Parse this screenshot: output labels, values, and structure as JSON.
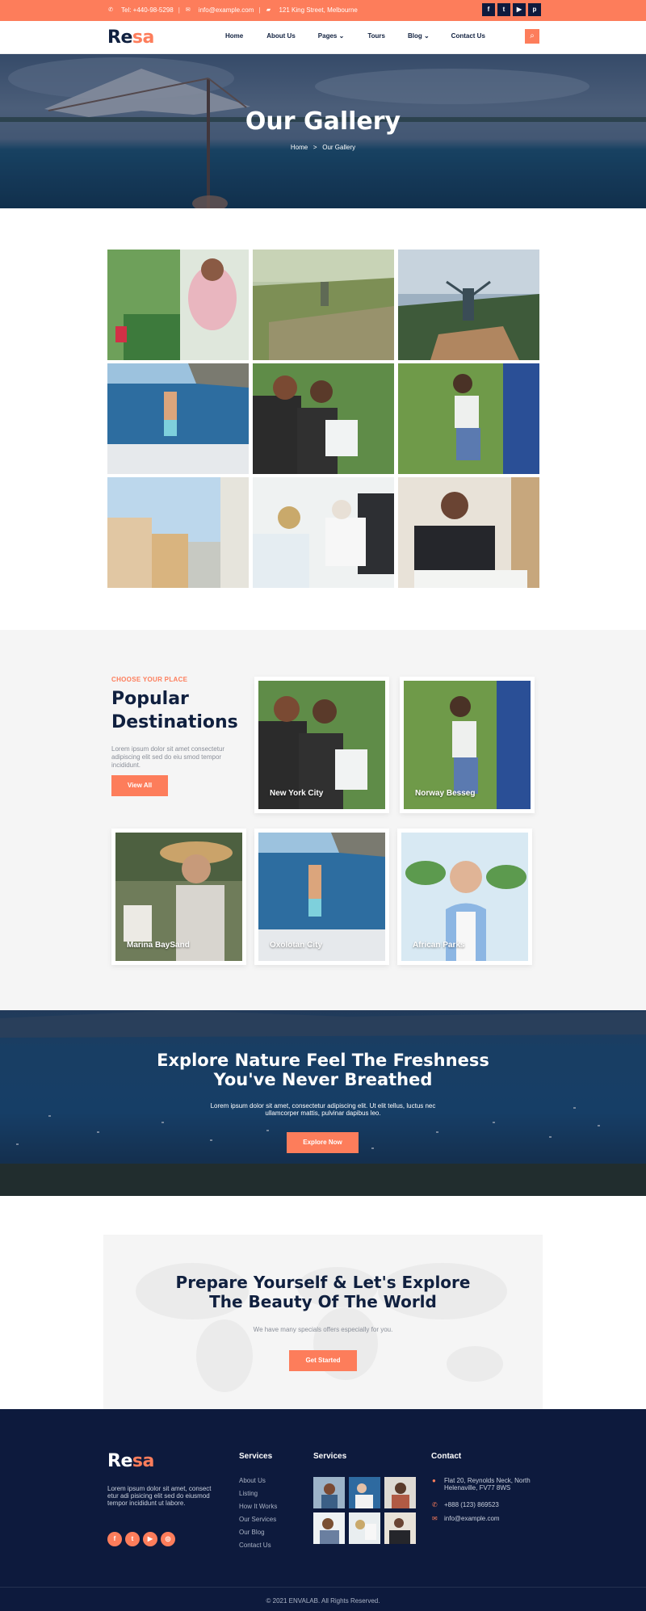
{
  "topbar": {
    "phone": "Tel: +440-98-5298",
    "email": "info@example.com",
    "address": "121 King Street, Melbourne",
    "socials": [
      "f",
      "t",
      "y",
      "p"
    ]
  },
  "brand": {
    "part1": "Re",
    "part2": "sa"
  },
  "nav": {
    "items": [
      "Home",
      "About Us",
      "Pages",
      "Tours",
      "Blog",
      "Contact Us"
    ]
  },
  "hero": {
    "title": "Our Gallery",
    "breadcrumb_home": "Home",
    "breadcrumb_sep": ">",
    "breadcrumb_current": "Our Gallery"
  },
  "destinations": {
    "kicker": "CHOOSE YOUR PLACE",
    "title": "Popular Destinations",
    "description": "Lorem ipsum dolor sit amet consectetur adipiscing elit sed do eiu smod tempor incididunt.",
    "button": "View All",
    "cards": [
      "New York City",
      "Norway Besseg",
      "Marina BaySand",
      "Oxolotan City",
      "African Parks"
    ]
  },
  "banner": {
    "title_line1": "Explore Nature Feel The Freshness",
    "title_line2": "You've Never Breathed",
    "text": "Lorem ipsum dolor sit amet, consectetur adipiscing elit. Ut elit tellus, luctus nec ullamcorper mattis, pulvinar dapibus leo.",
    "button": "Explore Now"
  },
  "cta": {
    "title_line1": "Prepare Yourself & Let's Explore",
    "title_line2": "The Beauty Of The World",
    "text": "We have many specials offers especially for you.",
    "button": "Get Started"
  },
  "footer": {
    "about": "Lorem ipsum dolor sit amet, consect etur adi pisicing elit sed do eiusmod tempor incididunt ut labore.",
    "socials": [
      "f",
      "t",
      "y",
      "i"
    ],
    "services_heading": "Services",
    "services": [
      "About Us",
      "Listing",
      "How It Works",
      "Our Services",
      "Our Blog",
      "Contact Us"
    ],
    "gallery_heading": "Services",
    "contact_heading": "Contact",
    "contact_address": "Flat 20, Reynolds Neck, North Helenaville, FV77 8WS",
    "contact_phone": "+888 (123) 869523",
    "contact_email": "info@example.com",
    "copyright": "© 2021 ENVALAB. All Rights Reserved."
  },
  "colors": {
    "accent": "#fd7d5b",
    "navy": "#0d1a3d",
    "light_bg": "#f5f5f5"
  },
  "icons": {
    "phone": "phone-icon",
    "mail": "mail-icon",
    "map": "map-icon",
    "search": "search-icon",
    "chevron": "chevron-down-icon"
  }
}
